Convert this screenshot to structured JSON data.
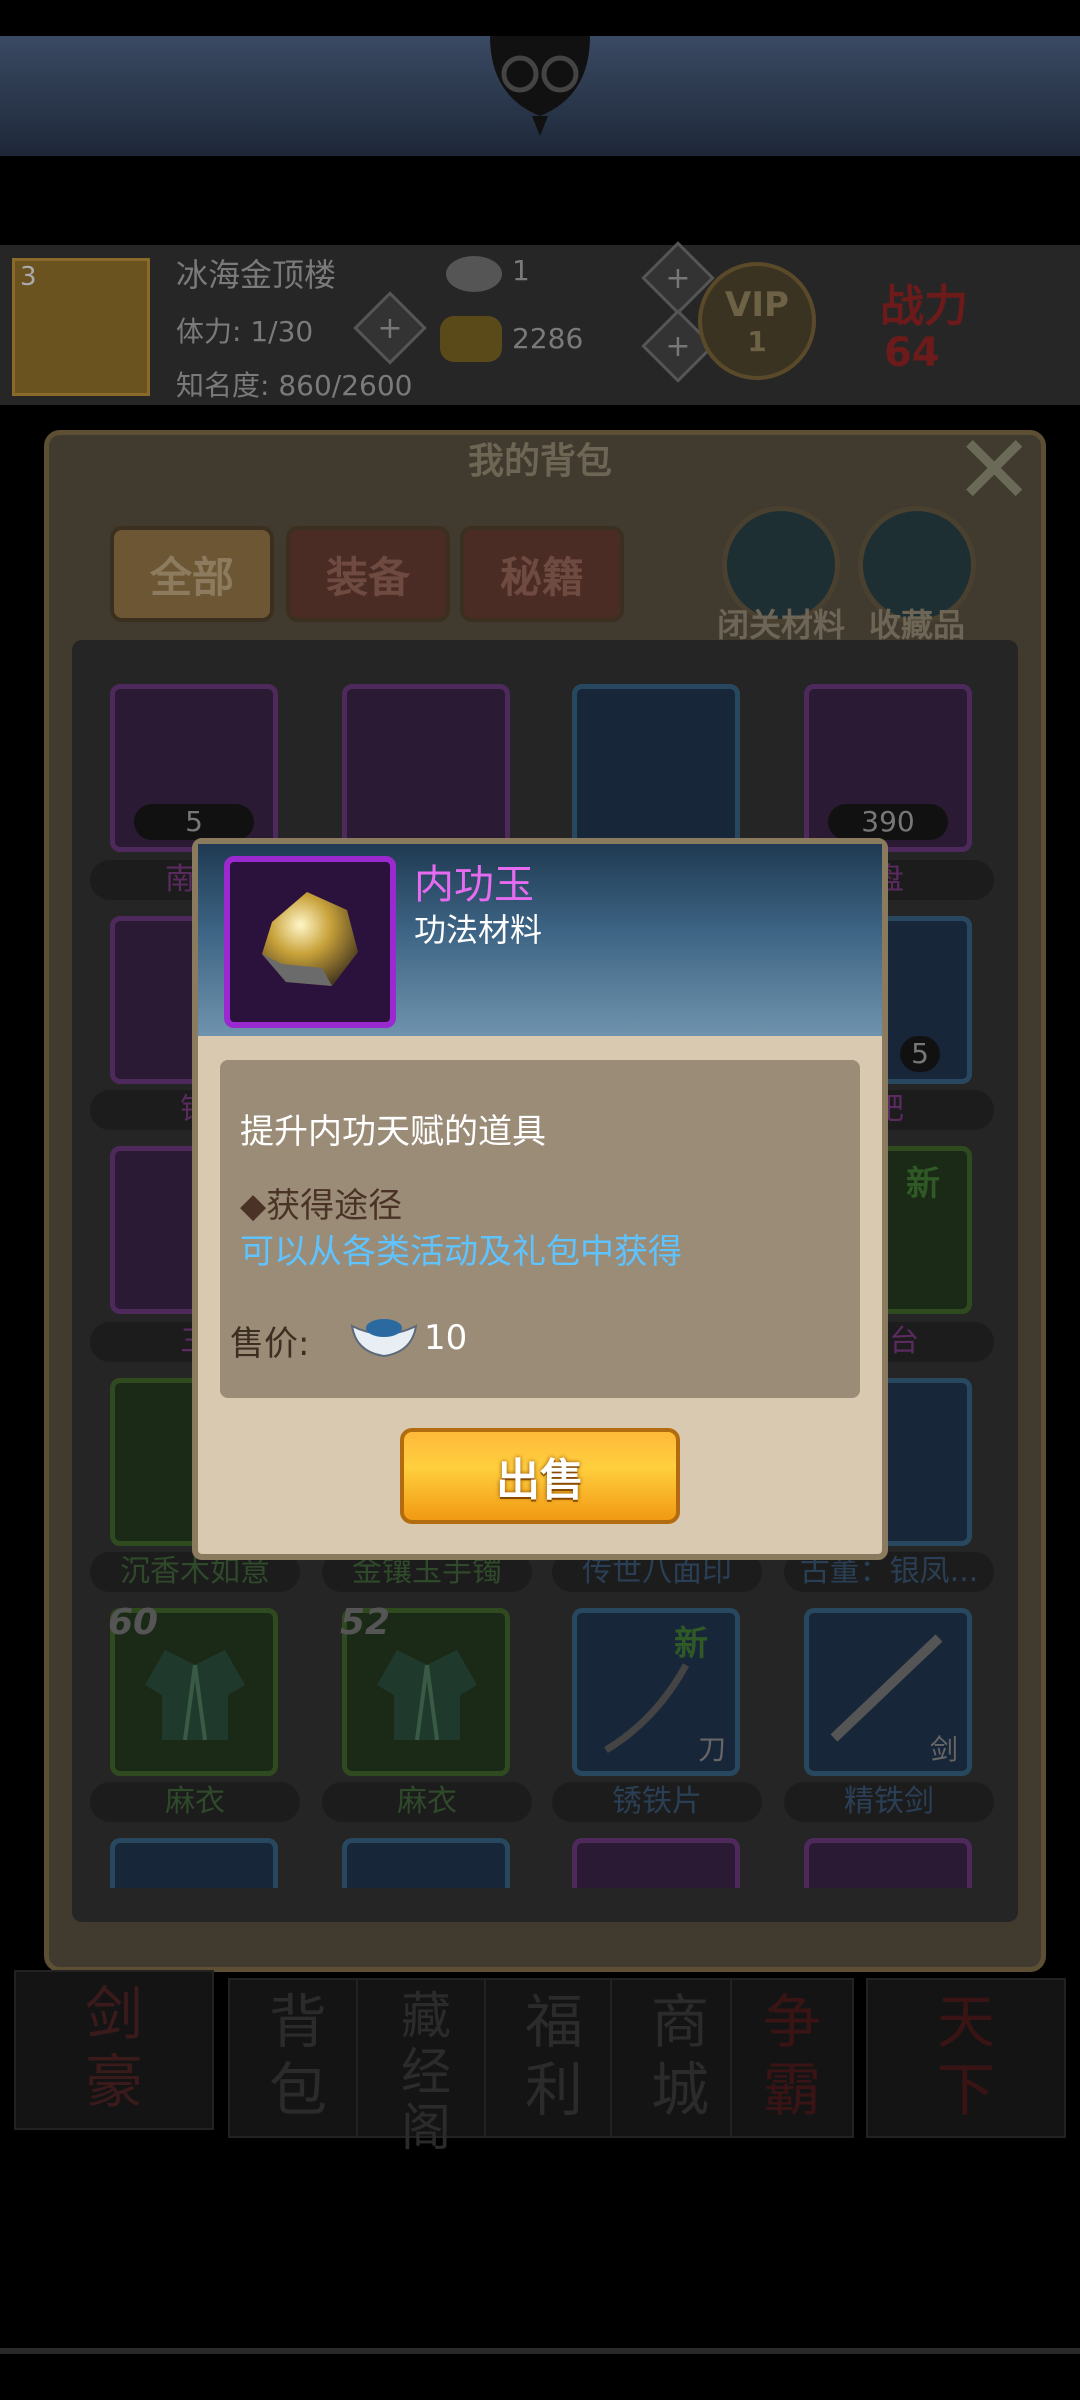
{
  "colors": {
    "popup_name": "#e76bf0",
    "source_link": "#5ec3ff",
    "sell_button": "#ffb93a"
  },
  "background_hud": {
    "location": "冰海金顶楼",
    "stamina": "体力: 1/30",
    "fame": "知名度: 860/2600",
    "level": "3",
    "silver": "1",
    "gold": "2286",
    "vip_label": "VIP",
    "vip_level": "1",
    "power_label": "战力",
    "power_value": "64"
  },
  "bag": {
    "title": "我的背包",
    "tabs": [
      {
        "label": "全部"
      },
      {
        "label": "装备"
      },
      {
        "label": "秘籍"
      }
    ],
    "round_buttons": [
      {
        "label": "闭关材料"
      },
      {
        "label": "收藏品"
      }
    ],
    "rows": [
      [
        {
          "name": "南方",
          "qty": "5"
        },
        {
          "name": ""
        },
        {
          "name": ""
        },
        {
          "name": "盘",
          "qty": "390"
        }
      ],
      [
        {
          "name": "锈"
        },
        {
          "name": ""
        },
        {
          "name": ""
        },
        {
          "name": "肥",
          "qty": "5"
        }
      ],
      [
        {
          "name": "三"
        },
        {
          "name": ""
        },
        {
          "name": ""
        },
        {
          "name": "烛台",
          "tag": "新"
        }
      ],
      [
        {
          "name": "沉香木如意"
        },
        {
          "name": "金镶玉手镯"
        },
        {
          "name": "传世八面印"
        },
        {
          "name": "古董：银凤..."
        }
      ],
      [
        {
          "name": "麻衣",
          "level": "60"
        },
        {
          "name": "麻衣",
          "level": "52"
        },
        {
          "name": "锈铁片",
          "corner": "刀",
          "tag": "新"
        },
        {
          "name": "精铁剑",
          "corner": "剑"
        }
      ]
    ]
  },
  "bottom_nav": [
    {
      "label": "剑\n豪"
    },
    {
      "label": "背\n包"
    },
    {
      "label": "藏\n经\n阁"
    },
    {
      "label": "福\n利"
    },
    {
      "label": "商\n城"
    },
    {
      "label": "争\n霸"
    },
    {
      "label": "天\n下"
    }
  ],
  "popup": {
    "item_name": "内功玉",
    "item_type": "功法材料",
    "description": "提升内功天赋的道具",
    "source_title": "◆获得途径",
    "source_text": "可以从各类活动及礼包中获得",
    "price_label": "售价:",
    "price_value": "10",
    "sell_label": "出售"
  }
}
